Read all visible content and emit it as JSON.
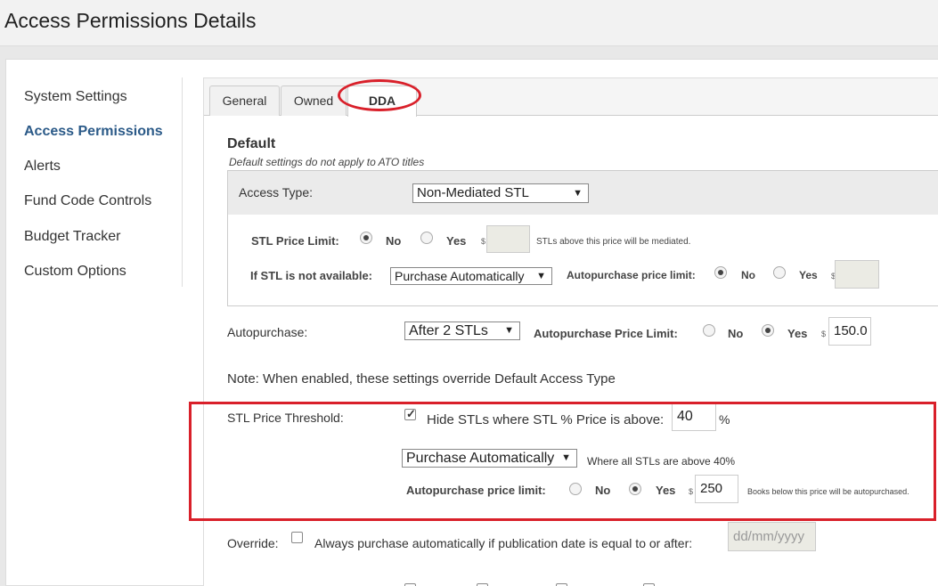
{
  "page_title": "Access Permissions Details",
  "nav": {
    "items": [
      {
        "label": "System Settings"
      },
      {
        "label": "Access Permissions"
      },
      {
        "label": "Alerts"
      },
      {
        "label": "Fund Code Controls"
      },
      {
        "label": "Budget Tracker"
      },
      {
        "label": "Custom Options"
      }
    ]
  },
  "tabs": [
    {
      "label": "General"
    },
    {
      "label": "Owned"
    },
    {
      "label": "DDA"
    }
  ],
  "default_section": {
    "title": "Default",
    "note": "Default settings do not apply to ATO titles",
    "access_type_label": "Access Type:",
    "access_type_value": "Non-Mediated STL",
    "stl_price_limit_label": "STL Price Limit:",
    "no_label": "No",
    "yes_label": "Yes",
    "dollar": "$",
    "stl_price_limit_value": "",
    "stl_price_limit_hint": "STLs above this price will be mediated.",
    "if_stl_label": "If STL is not available:",
    "if_stl_value": "Purchase Automatically",
    "autopurchase_price_limit_label": "Autopurchase price limit:",
    "autopurchase_price_limit_value": ""
  },
  "autopurchase": {
    "label": "Autopurchase:",
    "value": "After 2 STLs",
    "price_limit_label": "Autopurchase Price Limit:",
    "no_label": "No",
    "yes_label": "Yes",
    "dollar": "$",
    "price_limit_value": "150.0"
  },
  "override_note": "Note: When enabled, these settings override Default Access Type",
  "threshold": {
    "label": "STL Price Threshold:",
    "hide_label": "Hide STLs where STL % Price is above:",
    "hide_value": "40",
    "percent": "%",
    "action_value": "Purchase Automatically",
    "where_text": "Where all STLs are above 40%",
    "limit_label": "Autopurchase price limit:",
    "no_label": "No",
    "yes_label": "Yes",
    "dollar": "$",
    "limit_value": "250",
    "limit_hint": "Books below this price will be autopurchased."
  },
  "override": {
    "label": "Override:",
    "text": "Always purchase automatically if publication date is equal to or after:",
    "date_placeholder": "dd/mm/yyyy"
  }
}
